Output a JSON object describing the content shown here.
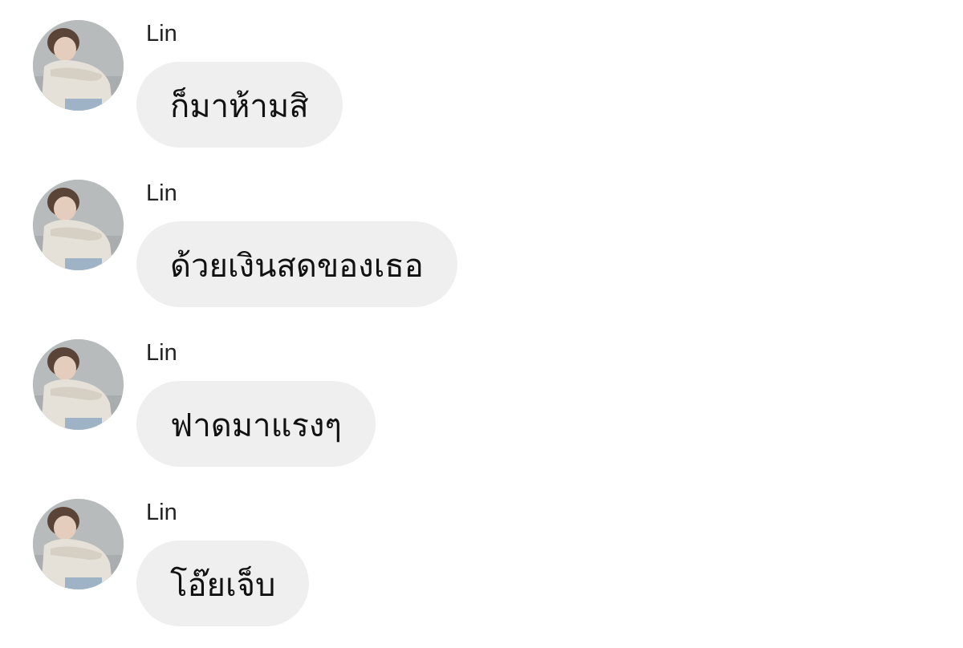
{
  "conversation": {
    "messages": [
      {
        "sender": "Lin",
        "text": "ก็มาห้ามสิ"
      },
      {
        "sender": "Lin",
        "text": "ด้วยเงินสดของเธอ"
      },
      {
        "sender": "Lin",
        "text": "ฟาดมาแรงๆ"
      },
      {
        "sender": "Lin",
        "text": "โอ๊ยเจ็บ"
      }
    ]
  },
  "colors": {
    "bubble_background": "#efefef",
    "page_background": "#ffffff",
    "text": "#111111"
  }
}
